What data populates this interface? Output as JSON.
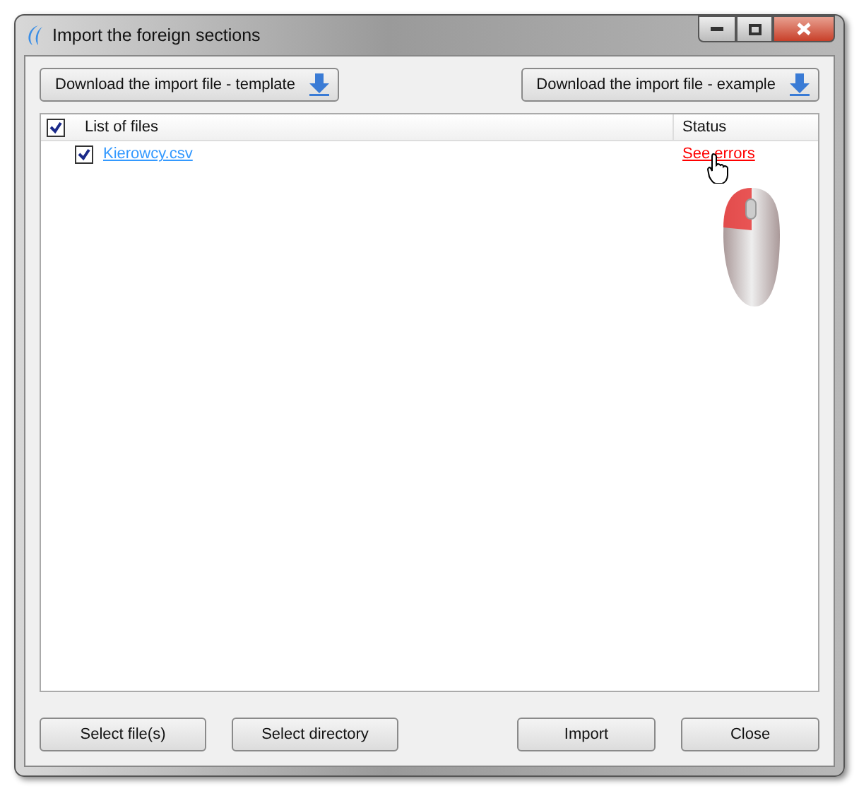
{
  "window": {
    "title": "Import the foreign sections"
  },
  "top_buttons": [
    "Download the import file - template",
    "Download the import file - example"
  ],
  "table": {
    "header_checked": true,
    "columns": [
      "List of files",
      "Status"
    ],
    "rows": [
      {
        "checked": true,
        "file": "Kierowcy.csv",
        "status": "See errors"
      }
    ]
  },
  "buttons_left": [
    "Select file(s)",
    "Select directory"
  ],
  "buttons_right": [
    "Import",
    "Close"
  ]
}
